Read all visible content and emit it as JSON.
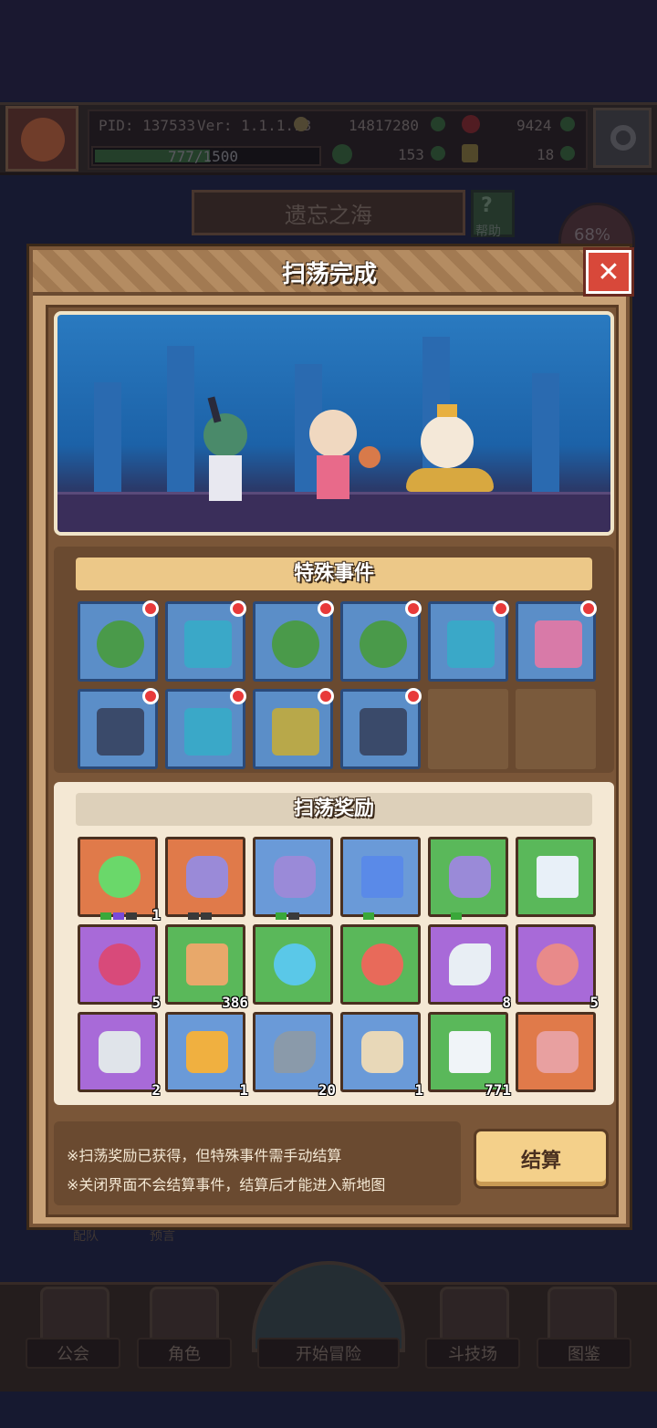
{
  "status": {
    "pid": "PID: 137533",
    "version": "Ver: 1.1.1.13",
    "gold": "14817280",
    "gems": "9424",
    "clover": "153",
    "keys": "18",
    "xp": "777/1500",
    "xp_fraction": 0.518
  },
  "map": {
    "title": "遗忘之海",
    "help_label": "帮助",
    "progress": "68%"
  },
  "modal": {
    "title": "扫荡完成",
    "close_label": "✕",
    "events_title": "特殊事件",
    "rewards_title": "扫荡奖励",
    "note1": "※扫荡奖励已获得，但特殊事件需手动结算",
    "note2": "※关闭界面不会结算事件，结算后才能进入新地图",
    "settle_label": "结算"
  },
  "events": [
    {
      "icon": "goblin-merchant-icon",
      "color": "#5b8ec8"
    },
    {
      "icon": "portal-door-icon",
      "color": "#5b8ec8"
    },
    {
      "icon": "goblin-merchant-icon",
      "color": "#5b8ec8"
    },
    {
      "icon": "goblin-merchant-icon",
      "color": "#5b8ec8"
    },
    {
      "icon": "portal-door-icon",
      "color": "#5b8ec8"
    },
    {
      "icon": "gift-box-icon",
      "color": "#5b8ec8"
    },
    {
      "icon": "treasure-chest-icon",
      "color": "#5b8ec8"
    },
    {
      "icon": "portal-door-icon",
      "color": "#5b8ec8"
    },
    {
      "icon": "golden-shrine-icon",
      "color": "#5b8ec8"
    },
    {
      "icon": "treasure-chest-icon",
      "color": "#5b8ec8"
    }
  ],
  "rewards": [
    {
      "icon": "four-leaf-clover-icon",
      "bg": "#e07a4a",
      "count": "1"
    },
    {
      "icon": "purple-orb-amulet-icon",
      "bg": "#e07a4a",
      "count": ""
    },
    {
      "icon": "purple-orb-amulet-icon",
      "bg": "#6a9ad8",
      "count": ""
    },
    {
      "icon": "blue-gem-amulet-icon",
      "bg": "#6a9ad8",
      "count": ""
    },
    {
      "icon": "purple-orb-amulet-icon",
      "bg": "#5ab85a",
      "count": ""
    },
    {
      "icon": "white-crystal-amulet-icon",
      "bg": "#5ab85a",
      "count": ""
    },
    {
      "icon": "red-fruit-icon",
      "bg": "#a86ad8",
      "count": "5"
    },
    {
      "icon": "orange-crystal-icon",
      "bg": "#5ab85a",
      "count": "386"
    },
    {
      "icon": "blue-slime-icon",
      "bg": "#5ab85a",
      "count": ""
    },
    {
      "icon": "red-slime-icon",
      "bg": "#5ab85a",
      "count": ""
    },
    {
      "icon": "white-fish-icon",
      "bg": "#a86ad8",
      "count": "8"
    },
    {
      "icon": "meat-steak-icon",
      "bg": "#a86ad8",
      "count": "5"
    },
    {
      "icon": "silver-ore-icon",
      "bg": "#a86ad8",
      "count": "2"
    },
    {
      "icon": "potion-bottle-icon",
      "bg": "#6a9ad8",
      "count": "1"
    },
    {
      "icon": "grey-fish-icon",
      "bg": "#6a9ad8",
      "count": "20"
    },
    {
      "icon": "bone-icon",
      "bg": "#6a9ad8",
      "count": "1"
    },
    {
      "icon": "diamond-icon",
      "bg": "#5ab85a",
      "count": "771"
    },
    {
      "icon": "monster-face-icon",
      "bg": "#e07a4a",
      "count": ""
    }
  ],
  "behind": {
    "tab1": "配队",
    "tab2": "预言"
  },
  "nav": {
    "guild": "公会",
    "character": "角色",
    "adventure": "开始冒险",
    "arena": "斗技场",
    "codex": "图鉴"
  }
}
